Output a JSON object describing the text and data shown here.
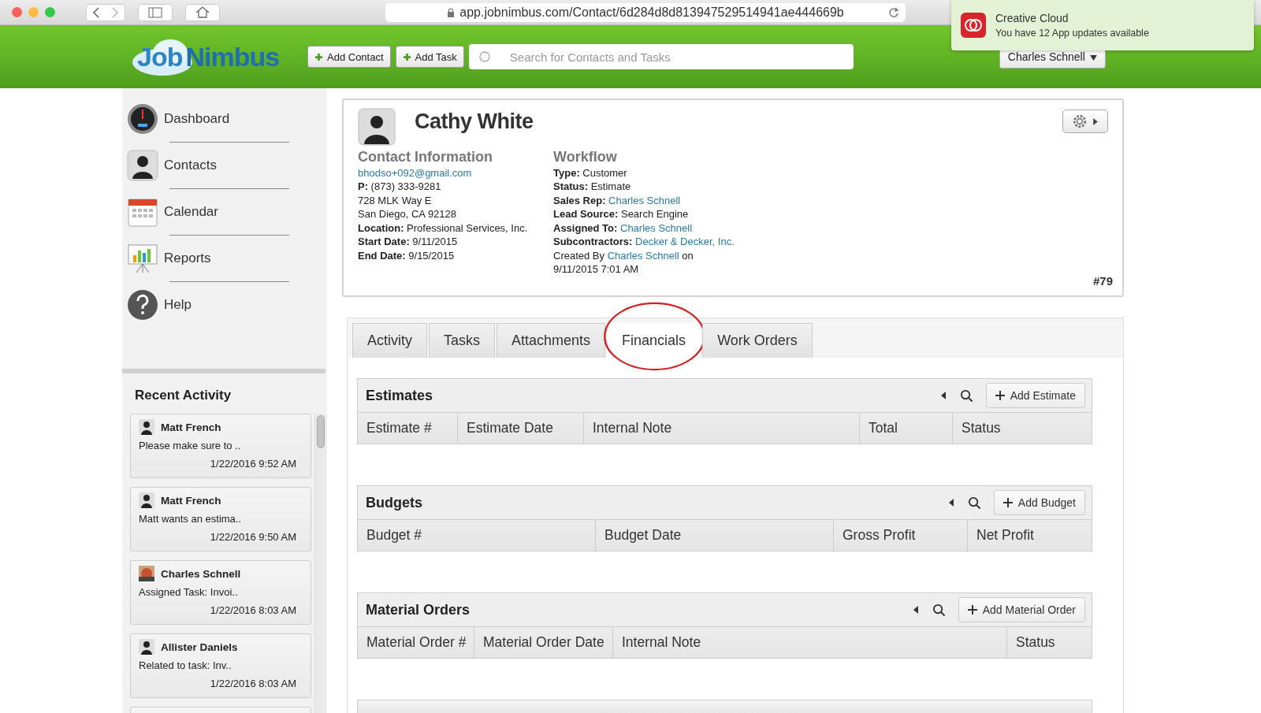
{
  "browser": {
    "url": "app.jobnimbus.com/Contact/6d284d8d813947529514941ae444669b"
  },
  "notification": {
    "title": "Creative Cloud",
    "message": "You have 12 App updates available"
  },
  "header": {
    "logo_parts": [
      "Job",
      "Nimbus"
    ],
    "buttons": [
      "Add Contact",
      "Add Task"
    ],
    "search": {
      "placeholder": "Search for Contacts and Tasks"
    },
    "user": "Charles Schnell"
  },
  "sidebar": {
    "items": [
      {
        "label": "Dashboard",
        "kind": "dashboard"
      },
      {
        "label": "Contacts",
        "kind": "contacts"
      },
      {
        "label": "Calendar",
        "kind": "calendar"
      },
      {
        "label": "Reports",
        "kind": "reports"
      },
      {
        "label": "Help",
        "kind": "help"
      }
    ],
    "recent_activity": {
      "title": "Recent Activity",
      "items": [
        {
          "name": "Matt French",
          "text": "Please make sure to ..",
          "time": "1/22/2016 9:52 AM",
          "kind": "person"
        },
        {
          "name": "Matt French",
          "text": "Matt wants an estima..",
          "time": "1/22/2016 9:50 AM",
          "kind": "person"
        },
        {
          "name": "Charles Schnell",
          "text": "Assigned Task: Invoi..",
          "time": "1/22/2016 8:03 AM",
          "kind": "picture"
        },
        {
          "name": "Allister Daniels",
          "text": "Related to task: Inv..",
          "time": "1/22/2016 8:03 AM",
          "kind": "person"
        }
      ]
    }
  },
  "contact": {
    "name": "Cathy White",
    "number": "#79",
    "contact_information": {
      "title": "Contact Information",
      "lines": [
        {
          "kind": "link",
          "value": "bhodso+092@gmail.com"
        },
        {
          "kind": "field",
          "label": "P:",
          "value": "(873) 333-9281"
        },
        {
          "kind": "text",
          "value": "728 MLK Way E"
        },
        {
          "kind": "text",
          "value": "San Diego, CA 92128"
        },
        {
          "kind": "field",
          "label": "Location:",
          "value": "Professional Services, Inc."
        },
        {
          "kind": "field",
          "label": "Start Date:",
          "value": "9/11/2015"
        },
        {
          "kind": "field",
          "label": "End Date:",
          "value": "9/15/2015"
        }
      ]
    },
    "workflow": {
      "title": "Workflow",
      "lines": [
        {
          "kind": "field",
          "label": "Type:",
          "value": "Customer"
        },
        {
          "kind": "field",
          "label": "Status:",
          "value": "Estimate"
        },
        {
          "kind": "link_field",
          "label": "Sales Rep:",
          "value": "Charles Schnell"
        },
        {
          "kind": "field",
          "label": "Lead Source:",
          "value": "Search Engine"
        },
        {
          "kind": "link_field",
          "label": "Assigned To:",
          "value": "Charles Schnell"
        },
        {
          "kind": "link_field",
          "label": "Subcontractors:",
          "value": "Decker & Decker, Inc."
        }
      ],
      "created": {
        "prefix": "Created By",
        "name": "Charles Schnell",
        "suffix": "on",
        "date": "9/11/2015 7:01 AM"
      }
    }
  },
  "tabs": [
    {
      "label": "Activity",
      "selected": false
    },
    {
      "label": "Tasks",
      "selected": false
    },
    {
      "label": "Attachments",
      "selected": false
    },
    {
      "label": "Financials",
      "selected": true,
      "circled": true
    },
    {
      "label": "Work Orders",
      "selected": false
    }
  ],
  "sections": [
    {
      "title": "Estimates",
      "add_button": "Add Estimate",
      "columns": [
        "Estimate #",
        "Estimate Date",
        "Internal Note",
        "Total",
        "Status"
      ]
    },
    {
      "title": "Budgets",
      "add_button": "Add Budget",
      "columns": [
        "Budget #",
        "Budget Date",
        "Gross Profit",
        "Net Profit"
      ]
    },
    {
      "title": "Material Orders",
      "add_button": "Add Material Order",
      "columns": [
        "Material Order #",
        "Material Order Date",
        "Internal Note",
        "Status"
      ]
    }
  ]
}
